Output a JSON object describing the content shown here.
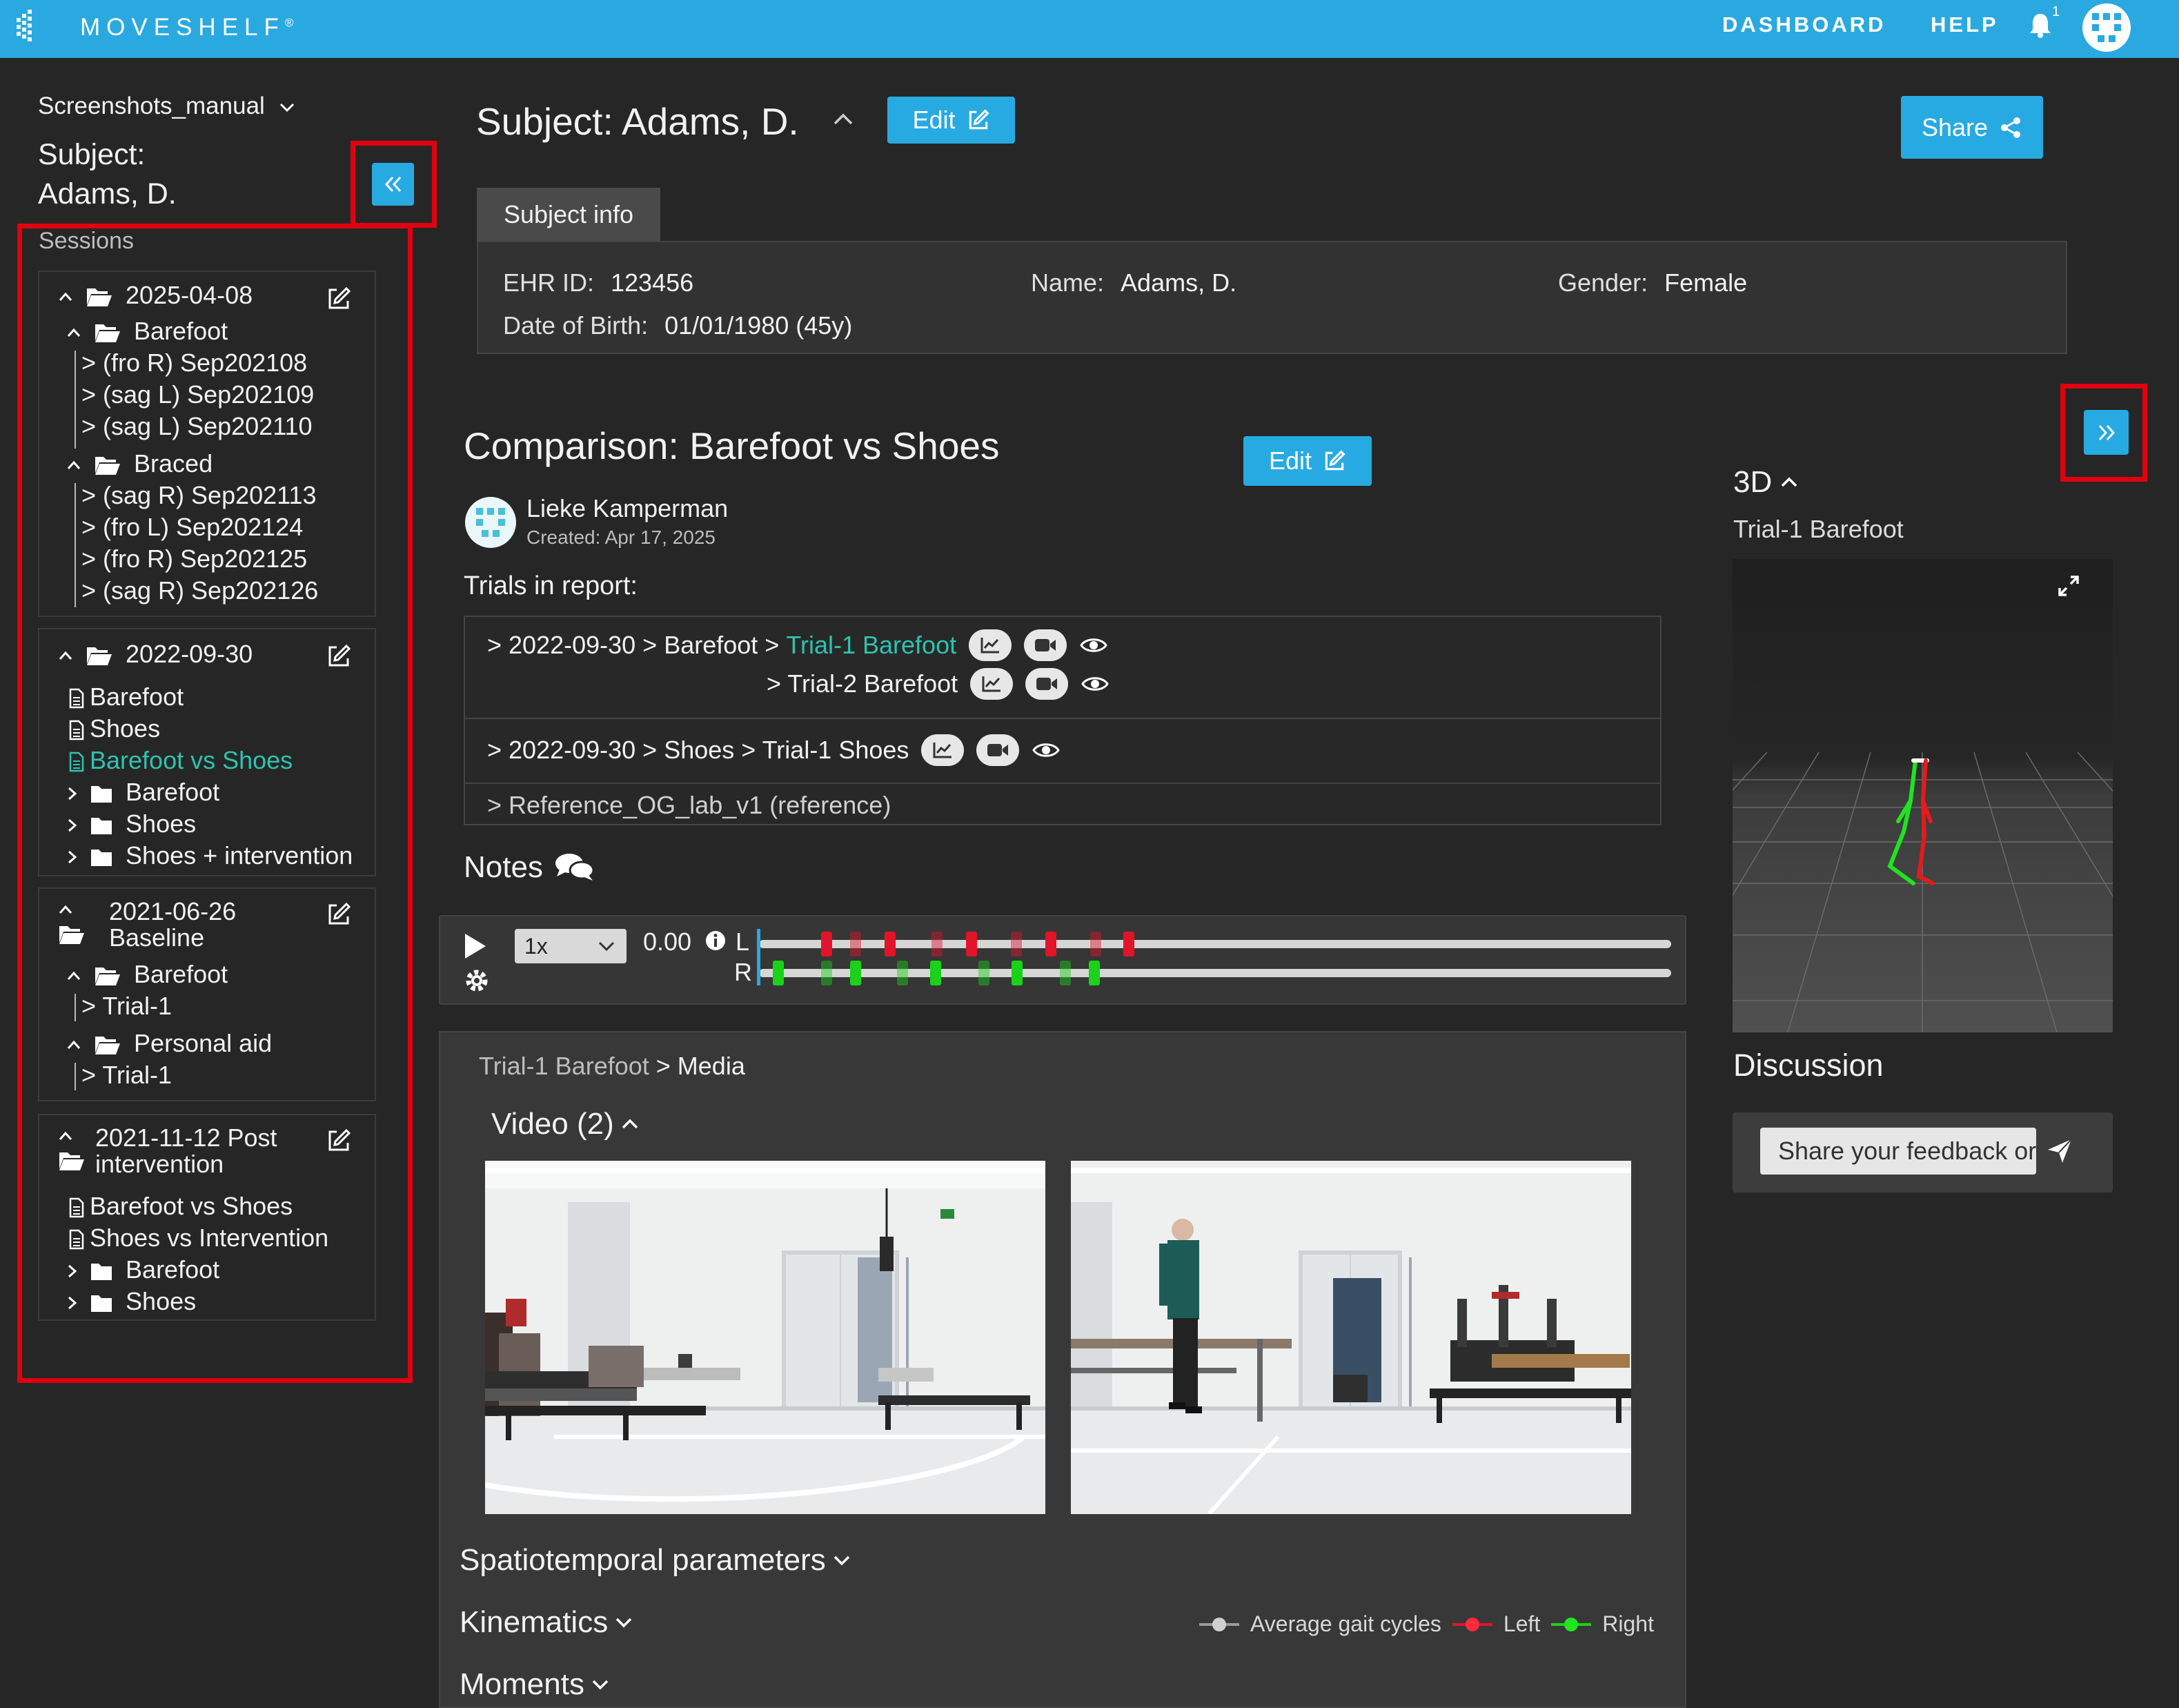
{
  "app": {
    "brand": "MOVESHELF",
    "brand_mark": "®"
  },
  "nav": {
    "dashboard": "DASHBOARD",
    "help": "HELP",
    "notifications_count": "1"
  },
  "sidebar": {
    "project": "Screenshots_manual",
    "subject_line1": "Subject:",
    "subject_line2": "Adams, D.",
    "sessions_label": "Sessions",
    "s1": {
      "date": "2025-04-08",
      "folder1": "Barefoot",
      "folder1_items": [
        "> (fro R) Sep202108",
        "> (sag L) Sep202109",
        "> (sag L) Sep202110"
      ],
      "folder2": "Braced",
      "folder2_items": [
        "> (sag R) Sep202113",
        "> (fro L) Sep202124",
        "> (fro R) Sep202125",
        "> (sag R) Sep202126"
      ]
    },
    "s2": {
      "date": "2022-09-30",
      "doc1": "Barefoot",
      "doc2": "Shoes",
      "doc3": "Barefoot vs Shoes",
      "folder1": "Barefoot",
      "folder2": "Shoes",
      "folder3": "Shoes + intervention"
    },
    "s3": {
      "title1": "2021-06-26",
      "title2": "Baseline",
      "folder1": "Barefoot",
      "folder1_item": "> Trial-1",
      "folder2": "Personal aid",
      "folder2_item": "> Trial-1"
    },
    "s4": {
      "title1": "2021-11-12 Post",
      "title2": "intervention",
      "doc1": "Barefoot vs Shoes",
      "doc2": "Shoes vs Intervention",
      "folder1": "Barefoot",
      "folder2": "Shoes"
    }
  },
  "header": {
    "title": "Subject: Adams, D.",
    "edit_label": "Edit",
    "share_label": "Share"
  },
  "subject_info": {
    "tab": "Subject info",
    "ehr_label": "EHR ID:",
    "ehr_value": "123456",
    "name_label": "Name:",
    "name_value": "Adams, D.",
    "gender_label": "Gender:",
    "gender_value": "Female",
    "dob_label": "Date of Birth:",
    "dob_value": "01/01/1980 (45y)"
  },
  "comparison": {
    "title": "Comparison: Barefoot vs Shoes",
    "edit_label": "Edit",
    "author": "Lieke Kamperman",
    "created": "Created: Apr 17, 2025",
    "trials_label": "Trials in report:",
    "trial1_prefix": "> 2022-09-30 > Barefoot > ",
    "trial1_link": "Trial-1 Barefoot",
    "trial2": "> Trial-2 Barefoot",
    "trial3": "> 2022-09-30 > Shoes > Trial-1 Shoes",
    "reference": "> Reference_OG_lab_v1 (reference)",
    "notes_label": "Notes"
  },
  "player": {
    "speed": "1x",
    "time": "0.00",
    "left_label": "L",
    "right_label": "R"
  },
  "media": {
    "breadcrumb_trial": "Trial-1 Barefoot",
    "breadcrumb_sep": " > ",
    "breadcrumb_current": "Media",
    "video_heading": "Video (2)",
    "spatiotemporal": "Spatiotemporal parameters",
    "kinematics": "Kinematics",
    "moments": "Moments"
  },
  "legend": {
    "avg": "Average gait cycles",
    "left": "Left",
    "right": "Right"
  },
  "colors": {
    "accent": "#27aae1",
    "teal_link": "#2ec3b0",
    "left": "#e1142a",
    "right": "#19d219",
    "highlight_box": "#e1000f"
  },
  "right_panel": {
    "heading_3d": "3D",
    "trial_label": "Trial-1 Barefoot",
    "discussion": "Discussion",
    "feedback_placeholder": "Share your feedback or"
  }
}
